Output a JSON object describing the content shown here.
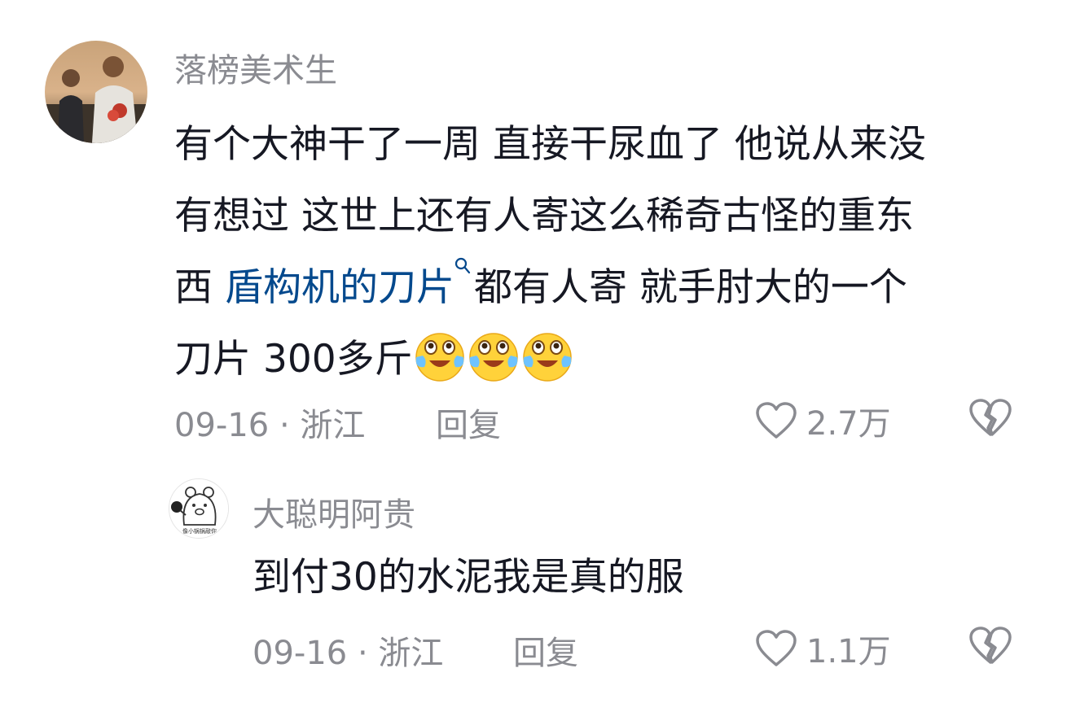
{
  "comments": [
    {
      "username": "落榜美术生",
      "text": {
        "line1": "有个大神干了一周 直接干尿血了 他说从来没",
        "line2": "有想过 这世上还有人寄这么稀奇古怪的重东",
        "line3_prefix": "西 ",
        "line3_link": "盾构机的刀片",
        "line3_suffix": "都有人寄 就手肘大的一个",
        "line4": "刀片 300多斤"
      },
      "emoji_name": "crying-laughing-emoji",
      "emoji_count": 3,
      "date": "09-16",
      "separator": "·",
      "location": "浙江",
      "reply_label": "回复",
      "like_count": "2.7万"
    },
    {
      "username": "大聪明阿贵",
      "avatar_caption": "像小锅锅敲你",
      "text": "到付30的水泥我是真的服",
      "date": "09-16",
      "separator": "·",
      "location": "浙江",
      "reply_label": "回复",
      "like_count": "1.1万"
    }
  ],
  "icons": {
    "like": "heart-outline-icon",
    "dislike": "broken-heart-icon",
    "search": "search-icon"
  },
  "colors": {
    "text": "#161823",
    "meta": "#8a8b91",
    "link": "#04498d"
  }
}
